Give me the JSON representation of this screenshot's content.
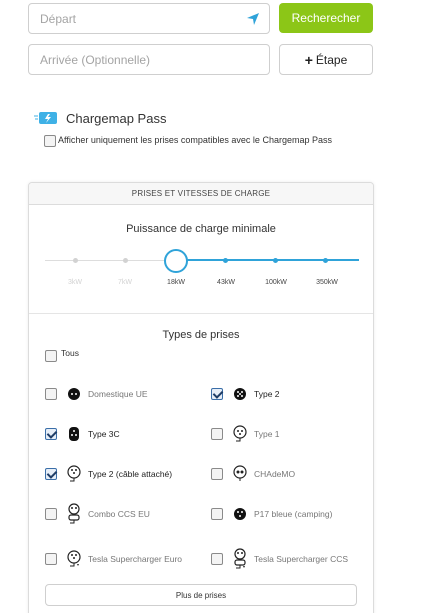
{
  "search": {
    "depart_placeholder": "Départ",
    "arrivee_placeholder": "Arrivée (Optionnelle)",
    "search_button": "Recherecher",
    "etape_button": "Étape"
  },
  "pass": {
    "title": "Chargemap Pass",
    "checkbox_label": "Afficher uniquement les prises compatibles avec le Chargemap Pass",
    "checked": false
  },
  "panel": {
    "header": "PRISES ET VITESSES DE CHARGE",
    "power_title": "Puissance de charge minimale",
    "power_ticks": [
      "3kW",
      "7kW",
      "18kW",
      "43kW",
      "100kW",
      "350kW"
    ],
    "selected_power": "18kW",
    "types_title": "Types de prises",
    "all_label": "Tous",
    "plugs": [
      {
        "label": "Domestique UE",
        "checked": false,
        "icon": "domestic-eu-plug-icon"
      },
      {
        "label": "Type 2",
        "checked": true,
        "icon": "type2-plug-icon"
      },
      {
        "label": "Type 3C",
        "checked": true,
        "icon": "type3c-plug-icon"
      },
      {
        "label": "Type 1",
        "checked": false,
        "icon": "type1-plug-icon"
      },
      {
        "label": "Type 2 (câble attaché)",
        "checked": true,
        "icon": "type2-cable-plug-icon"
      },
      {
        "label": "CHAdeMO",
        "checked": false,
        "icon": "chademo-plug-icon"
      },
      {
        "label": "Combo CCS EU",
        "checked": false,
        "icon": "combo-ccs-plug-icon"
      },
      {
        "label": "P17 bleue (camping)",
        "checked": false,
        "icon": "p17-plug-icon"
      },
      {
        "label": "Tesla Supercharger Euro",
        "checked": false,
        "icon": "tesla-euro-plug-icon"
      },
      {
        "label": "Tesla Supercharger CCS",
        "checked": false,
        "icon": "tesla-ccs-plug-icon"
      }
    ],
    "more_button": "Plus de prises"
  },
  "colors": {
    "accent_green": "#8cc617",
    "accent_blue": "#2fa3d9"
  }
}
